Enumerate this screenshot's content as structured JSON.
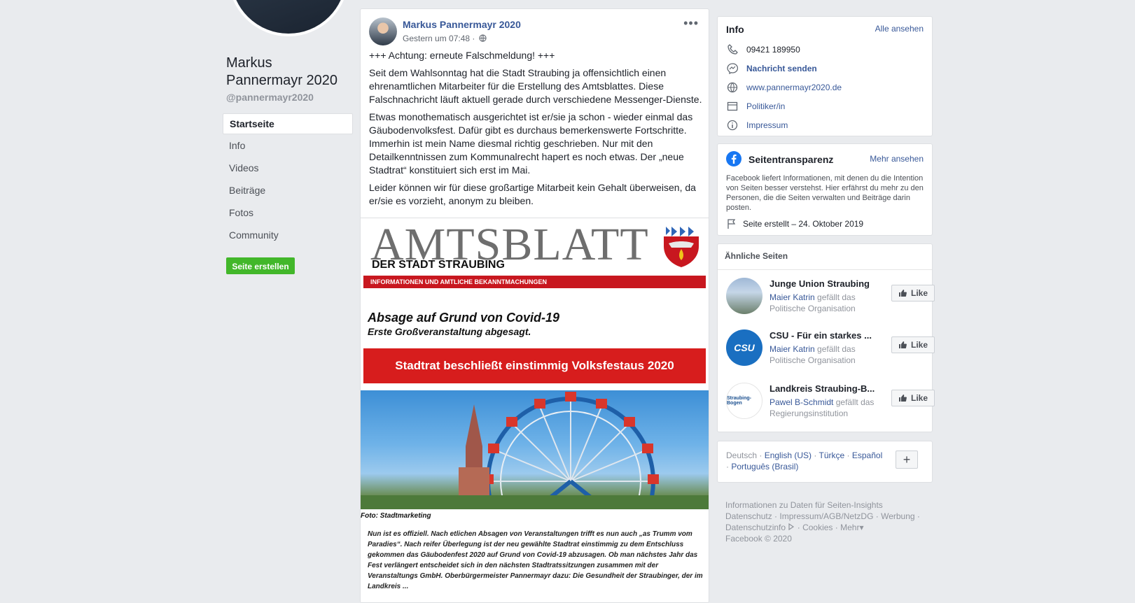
{
  "left": {
    "page_name": "Markus Pannermayr 2020",
    "handle": "@pannermayr2020",
    "nav": [
      "Startseite",
      "Info",
      "Videos",
      "Beiträge",
      "Fotos",
      "Community"
    ],
    "create_button": "Seite erstellen"
  },
  "post": {
    "author": "Markus Pannermayr 2020",
    "time": "Gestern um 07:48 ·",
    "menu": "•••",
    "paragraphs": [
      "+++ Achtung: erneute Falschmeldung! +++",
      "Seit dem Wahlsonntag hat die Stadt Straubing ja offensichtlich einen ehrenamtlichen Mitarbeiter für die Erstellung des Amtsblattes. Diese Falschnachricht läuft aktuell gerade durch verschiedene Messenger-Dienste.",
      "Etwas monothematisch ausgerichtet ist er/sie ja schon - wieder einmal das Gäubodenvolksfest. Dafür gibt es durchaus bemerkenswerte Fortschritte. Immerhin ist mein Name diesmal richtig geschrieben. Nur mit den Detailkenntnissen zum Kommunalrecht hapert es noch etwas. Der „neue Stadtrat“ konstituiert sich erst im Mai.",
      "Leider können wir für diese großartige Mitarbeit kein Gehalt überweisen, da er/sie es vorzieht, anonym zu bleiben."
    ],
    "image": {
      "title": "AMTSBLATT",
      "subtitle": "DER STADT STRAUBING",
      "bar_text": "INFORMATIONEN UND AMTLICHE BEKANNTMACHUNGEN",
      "headline": "Absage auf Grund von Covid-19",
      "subheadline": "Erste Großveranstaltung abgesagt.",
      "banner": "Stadtrat beschließt einstimmig Volksfestaus 2020",
      "photo_credit": "Foto: Stadtmarketing",
      "body": "Nun ist es offiziell. Nach etlichen Absagen von Veranstaltungen trifft es nun auch „as Trumm vom Paradies“. Nach reifer Überlegung ist der neu gewählte Stadtrat einstimmig zu dem Entschluss gekommen das Gäubodenfest 2020 auf Grund von Covid-19 abzusagen. Ob man nächstes Jahr das Fest verlängert entscheidet sich in den nächsten Stadtratssitzungen zusammen mit der Veranstaltungs GmbH. Oberbürgermeister Pannermayr dazu: Die Gesundheit der Straubinger, der im Landkreis ..."
    }
  },
  "info_card": {
    "title": "Info",
    "see_all": "Alle ansehen",
    "rows": [
      {
        "icon": "phone-icon",
        "text": "09421 189950",
        "link": false
      },
      {
        "icon": "messenger-icon",
        "text": "Nachricht senden",
        "link": true
      },
      {
        "icon": "globe-icon",
        "text": "www.pannermayr2020.de",
        "link": true
      },
      {
        "icon": "category-icon",
        "text": "Politiker/in",
        "link": true
      },
      {
        "icon": "info-icon",
        "text": "Impressum",
        "link": true
      }
    ]
  },
  "transparency": {
    "title": "Seitentransparenz",
    "see_more": "Mehr ansehen",
    "desc": "Facebook liefert Informationen, mit denen du die Intention von Seiten besser verstehst. Hier erfährst du mehr zu den Personen, die die Seiten verwalten und Beiträge darin posten.",
    "created": "Seite erstellt – 24. Oktober 2019"
  },
  "similar": {
    "title": "Ähnliche Seiten",
    "like_label": "Like",
    "pages": [
      {
        "name": "Junge Union Straubing",
        "who": "Maier Katrin",
        "liked": "gefällt das",
        "category": "Politische Organisation"
      },
      {
        "name": "CSU - Für ein starkes ...",
        "who": "Maier Katrin",
        "liked": "gefällt das",
        "category": "Politische Organisation"
      },
      {
        "name": "Landkreis Straubing-B...",
        "who": "Pawel B-Schmidt",
        "liked": "gefällt das",
        "category": "Regierungsinstitution"
      }
    ]
  },
  "languages": {
    "current": "Deutsch",
    "others": [
      "English (US)",
      "Türkçe",
      "Español",
      "Português (Brasil)"
    ],
    "add": "+"
  },
  "footer": {
    "line1": "Informationen zu Daten für Seiten-Insights",
    "links": [
      "Datenschutz",
      "Impressum/AGB/NetzDG",
      "Werbung",
      "Datenschutzinfo",
      "Cookies",
      "Mehr"
    ],
    "copyright": "Facebook © 2020"
  },
  "colors": {
    "fb_blue": "#385898",
    "green": "#42b72a",
    "bg": "#e9ebee",
    "red": "#c8171f"
  }
}
